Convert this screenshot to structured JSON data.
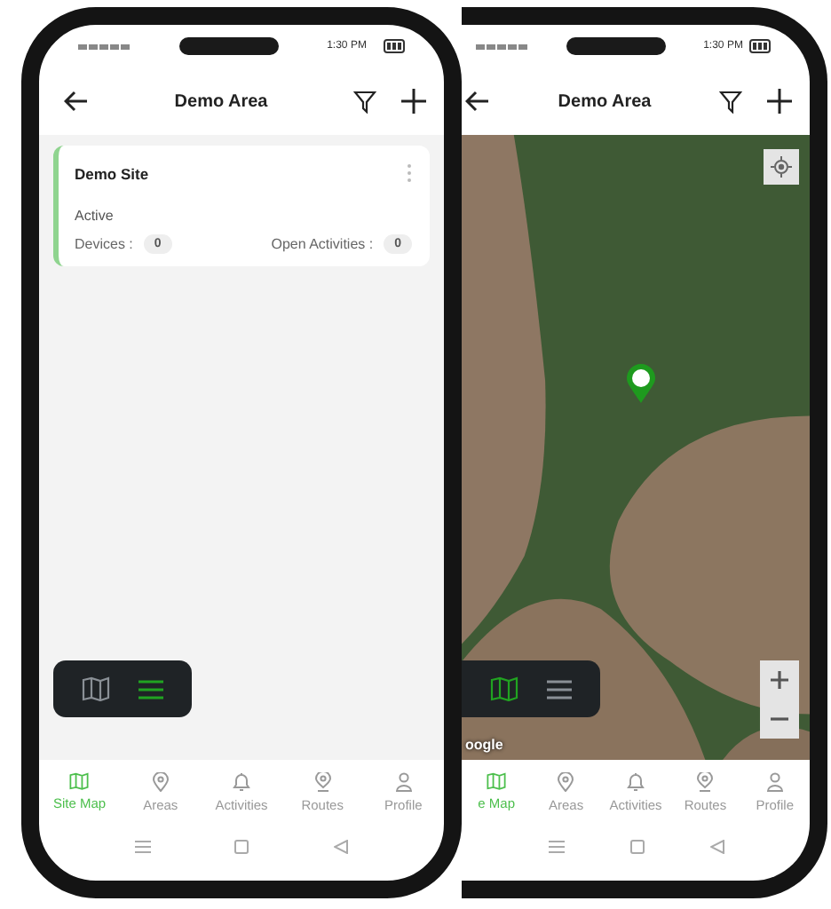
{
  "phones": [
    {
      "kind": "list",
      "status_bar": {
        "time": "1:30 PM"
      },
      "header": {
        "title": "Demo Area"
      },
      "sites": [
        {
          "name": "Demo Site",
          "status": "Active",
          "devices_label": "Devices :",
          "devices": "0",
          "activities_label": "Open Activities :",
          "activities": "0"
        }
      ],
      "view_toggle": [
        {
          "kind": "map",
          "selected": false
        },
        {
          "kind": "list",
          "selected": true
        }
      ],
      "nav": [
        {
          "label": "Site Map",
          "kind": "map",
          "selected": true
        },
        {
          "label": "Areas",
          "kind": "pin",
          "selected": false
        },
        {
          "label": "Activities",
          "kind": "bell",
          "selected": false
        },
        {
          "label": "Routes",
          "kind": "route",
          "selected": false
        },
        {
          "label": "Profile",
          "kind": "person",
          "selected": false
        }
      ]
    },
    {
      "kind": "map",
      "status_bar": {
        "time": "1:30 PM"
      },
      "header": {
        "title": "Demo Area"
      },
      "map": {
        "attribution": "oogle"
      },
      "view_toggle": [
        {
          "kind": "map",
          "selected": true
        },
        {
          "kind": "list",
          "selected": false
        }
      ],
      "nav": [
        {
          "label": "e Map",
          "kind": "map",
          "selected": true
        },
        {
          "label": "Areas",
          "kind": "pin",
          "selected": false
        },
        {
          "label": "Activities",
          "kind": "bell",
          "selected": false
        },
        {
          "label": "Routes",
          "kind": "route",
          "selected": false
        },
        {
          "label": "Profile",
          "kind": "person",
          "selected": false
        }
      ]
    }
  ]
}
